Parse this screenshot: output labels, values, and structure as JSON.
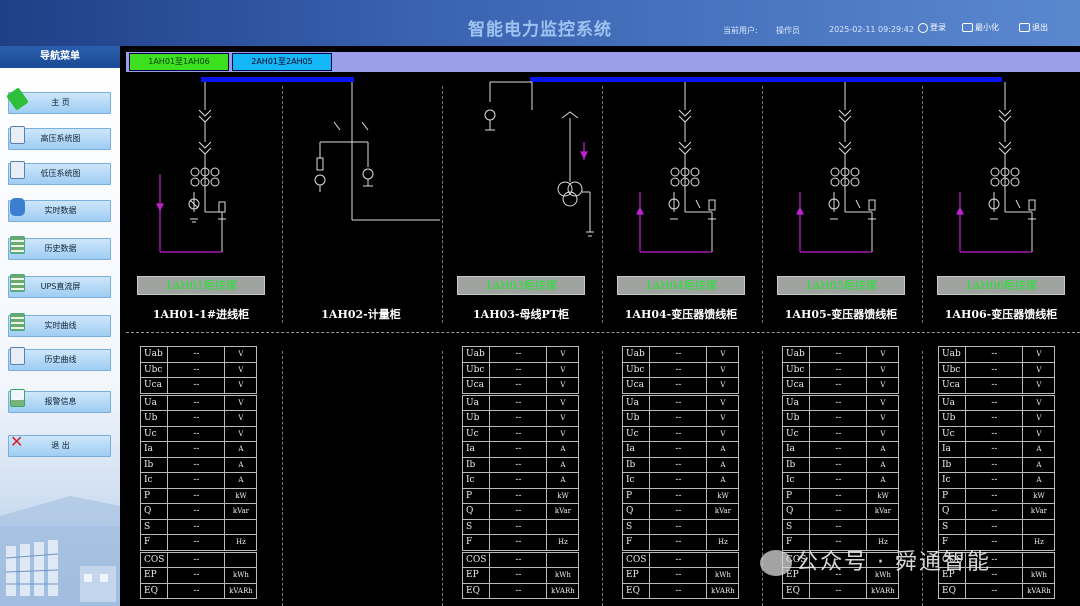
{
  "header": {
    "title": "智能电力监控系统",
    "user_label": "当前用户:",
    "user_name": "操作员",
    "datetime": "2025-02-11 09:29:42",
    "login_label": "登录",
    "minimize_label": "最小化",
    "exit_label": "退出"
  },
  "sidebar": {
    "title": "导航菜单",
    "items": [
      {
        "label": "主 页",
        "icon": "tag-icon"
      },
      {
        "label": "高压系统图",
        "icon": "document-icon"
      },
      {
        "label": "低压系统图",
        "icon": "document-icon"
      },
      {
        "label": "实时数据",
        "icon": "database-icon"
      },
      {
        "label": "历史数据",
        "icon": "table-icon"
      },
      {
        "label": "UPS直流屏",
        "icon": "table-icon"
      },
      {
        "label": "实时曲线",
        "icon": "table-icon"
      },
      {
        "label": "历史曲线",
        "icon": "document-icon"
      },
      {
        "label": "报警信息",
        "icon": "report-icon"
      },
      {
        "label": "退 出",
        "icon": "close-icon"
      }
    ]
  },
  "tabs": [
    {
      "label": "1AH01至1AH06",
      "active": true
    },
    {
      "label": "2AH01至2AH05",
      "active": false
    }
  ],
  "cabinets": [
    {
      "badge": "1AH01柜综保",
      "name": "1AH01-1#进线柜",
      "has_table": true,
      "params": [
        {
          "name": "Uab",
          "value": "--",
          "unit": "V"
        },
        {
          "name": "Ubc",
          "value": "--",
          "unit": "V"
        },
        {
          "name": "Uca",
          "value": "--",
          "unit": "V"
        },
        {
          "name": "Ua",
          "value": "--",
          "unit": "V"
        },
        {
          "name": "Ub",
          "value": "--",
          "unit": "V"
        },
        {
          "name": "Uc",
          "value": "--",
          "unit": "V"
        },
        {
          "name": "Ia",
          "value": "--",
          "unit": "A"
        },
        {
          "name": "Ib",
          "value": "--",
          "unit": "A"
        },
        {
          "name": "Ic",
          "value": "--",
          "unit": "A"
        },
        {
          "name": "P",
          "value": "--",
          "unit": "kW"
        },
        {
          "name": "Q",
          "value": "--",
          "unit": "kVar"
        },
        {
          "name": "S",
          "value": "--",
          "unit": ""
        },
        {
          "name": "F",
          "value": "--",
          "unit": "Hz"
        },
        {
          "name": "COS",
          "value": "--",
          "unit": ""
        },
        {
          "name": "EP",
          "value": "--",
          "unit": "kWh"
        },
        {
          "name": "EQ",
          "value": "--",
          "unit": "kVARh"
        }
      ]
    },
    {
      "badge": "",
      "name": "1AH02-计量柜",
      "has_table": false,
      "params": []
    },
    {
      "badge": "1AH03柜综保",
      "name": "1AH03-母线PT柜",
      "has_table": true,
      "params": [
        {
          "name": "Uab",
          "value": "--",
          "unit": "V"
        },
        {
          "name": "Ubc",
          "value": "--",
          "unit": "V"
        },
        {
          "name": "Uca",
          "value": "--",
          "unit": "V"
        },
        {
          "name": "Ua",
          "value": "--",
          "unit": "V"
        },
        {
          "name": "Ub",
          "value": "--",
          "unit": "V"
        },
        {
          "name": "Uc",
          "value": "--",
          "unit": "V"
        },
        {
          "name": "Ia",
          "value": "--",
          "unit": "A"
        },
        {
          "name": "Ib",
          "value": "--",
          "unit": "A"
        },
        {
          "name": "Ic",
          "value": "--",
          "unit": "A"
        },
        {
          "name": "P",
          "value": "--",
          "unit": "kW"
        },
        {
          "name": "Q",
          "value": "--",
          "unit": "kVar"
        },
        {
          "name": "S",
          "value": "--",
          "unit": ""
        },
        {
          "name": "F",
          "value": "--",
          "unit": "Hz"
        },
        {
          "name": "COS",
          "value": "--",
          "unit": ""
        },
        {
          "name": "EP",
          "value": "--",
          "unit": "kWh"
        },
        {
          "name": "EQ",
          "value": "--",
          "unit": "kVARh"
        }
      ]
    },
    {
      "badge": "1AH04柜综保",
      "name": "1AH04-变压器馈线柜",
      "has_table": true,
      "params": [
        {
          "name": "Uab",
          "value": "--",
          "unit": "V"
        },
        {
          "name": "Ubc",
          "value": "--",
          "unit": "V"
        },
        {
          "name": "Uca",
          "value": "--",
          "unit": "V"
        },
        {
          "name": "Ua",
          "value": "--",
          "unit": "V"
        },
        {
          "name": "Ub",
          "value": "--",
          "unit": "V"
        },
        {
          "name": "Uc",
          "value": "--",
          "unit": "V"
        },
        {
          "name": "Ia",
          "value": "--",
          "unit": "A"
        },
        {
          "name": "Ib",
          "value": "--",
          "unit": "A"
        },
        {
          "name": "Ic",
          "value": "--",
          "unit": "A"
        },
        {
          "name": "P",
          "value": "--",
          "unit": "kW"
        },
        {
          "name": "Q",
          "value": "--",
          "unit": "kVar"
        },
        {
          "name": "S",
          "value": "--",
          "unit": ""
        },
        {
          "name": "F",
          "value": "--",
          "unit": "Hz"
        },
        {
          "name": "COS",
          "value": "--",
          "unit": ""
        },
        {
          "name": "EP",
          "value": "--",
          "unit": "kWh"
        },
        {
          "name": "EQ",
          "value": "--",
          "unit": "kVARh"
        }
      ]
    },
    {
      "badge": "1AH05柜综保",
      "name": "1AH05-变压器馈线柜",
      "has_table": true,
      "params": [
        {
          "name": "Uab",
          "value": "--",
          "unit": "V"
        },
        {
          "name": "Ubc",
          "value": "--",
          "unit": "V"
        },
        {
          "name": "Uca",
          "value": "--",
          "unit": "V"
        },
        {
          "name": "Ua",
          "value": "--",
          "unit": "V"
        },
        {
          "name": "Ub",
          "value": "--",
          "unit": "V"
        },
        {
          "name": "Uc",
          "value": "--",
          "unit": "V"
        },
        {
          "name": "Ia",
          "value": "--",
          "unit": "A"
        },
        {
          "name": "Ib",
          "value": "--",
          "unit": "A"
        },
        {
          "name": "Ic",
          "value": "--",
          "unit": "A"
        },
        {
          "name": "P",
          "value": "--",
          "unit": "kW"
        },
        {
          "name": "Q",
          "value": "--",
          "unit": "kVar"
        },
        {
          "name": "S",
          "value": "--",
          "unit": ""
        },
        {
          "name": "F",
          "value": "--",
          "unit": "Hz"
        },
        {
          "name": "COS",
          "value": "--",
          "unit": ""
        },
        {
          "name": "EP",
          "value": "--",
          "unit": "kWh"
        },
        {
          "name": "EQ",
          "value": "--",
          "unit": "kVARh"
        }
      ]
    },
    {
      "badge": "1AH06柜综保",
      "name": "1AH06-变压器馈线柜",
      "has_table": true,
      "params": [
        {
          "name": "Uab",
          "value": "--",
          "unit": "V"
        },
        {
          "name": "Ubc",
          "value": "--",
          "unit": "V"
        },
        {
          "name": "Uca",
          "value": "--",
          "unit": "V"
        },
        {
          "name": "Ua",
          "value": "--",
          "unit": "V"
        },
        {
          "name": "Ub",
          "value": "--",
          "unit": "V"
        },
        {
          "name": "Uc",
          "value": "--",
          "unit": "V"
        },
        {
          "name": "Ia",
          "value": "--",
          "unit": "A"
        },
        {
          "name": "Ib",
          "value": "--",
          "unit": "A"
        },
        {
          "name": "Ic",
          "value": "--",
          "unit": "A"
        },
        {
          "name": "P",
          "value": "--",
          "unit": "kW"
        },
        {
          "name": "Q",
          "value": "--",
          "unit": "kVar"
        },
        {
          "name": "S",
          "value": "--",
          "unit": ""
        },
        {
          "name": "F",
          "value": "--",
          "unit": "Hz"
        },
        {
          "name": "COS",
          "value": "--",
          "unit": ""
        },
        {
          "name": "EP",
          "value": "--",
          "unit": "kWh"
        },
        {
          "name": "EQ",
          "value": "--",
          "unit": "kVARh"
        }
      ]
    }
  ],
  "watermark": "公众号 · 舜通智能",
  "colors": {
    "busbar": "#0a14ee",
    "badge_text": "#1fe62e",
    "active_tab": "#3de01f",
    "inactive_tab": "#15b6f5",
    "feeder_line": "#c020d0"
  }
}
